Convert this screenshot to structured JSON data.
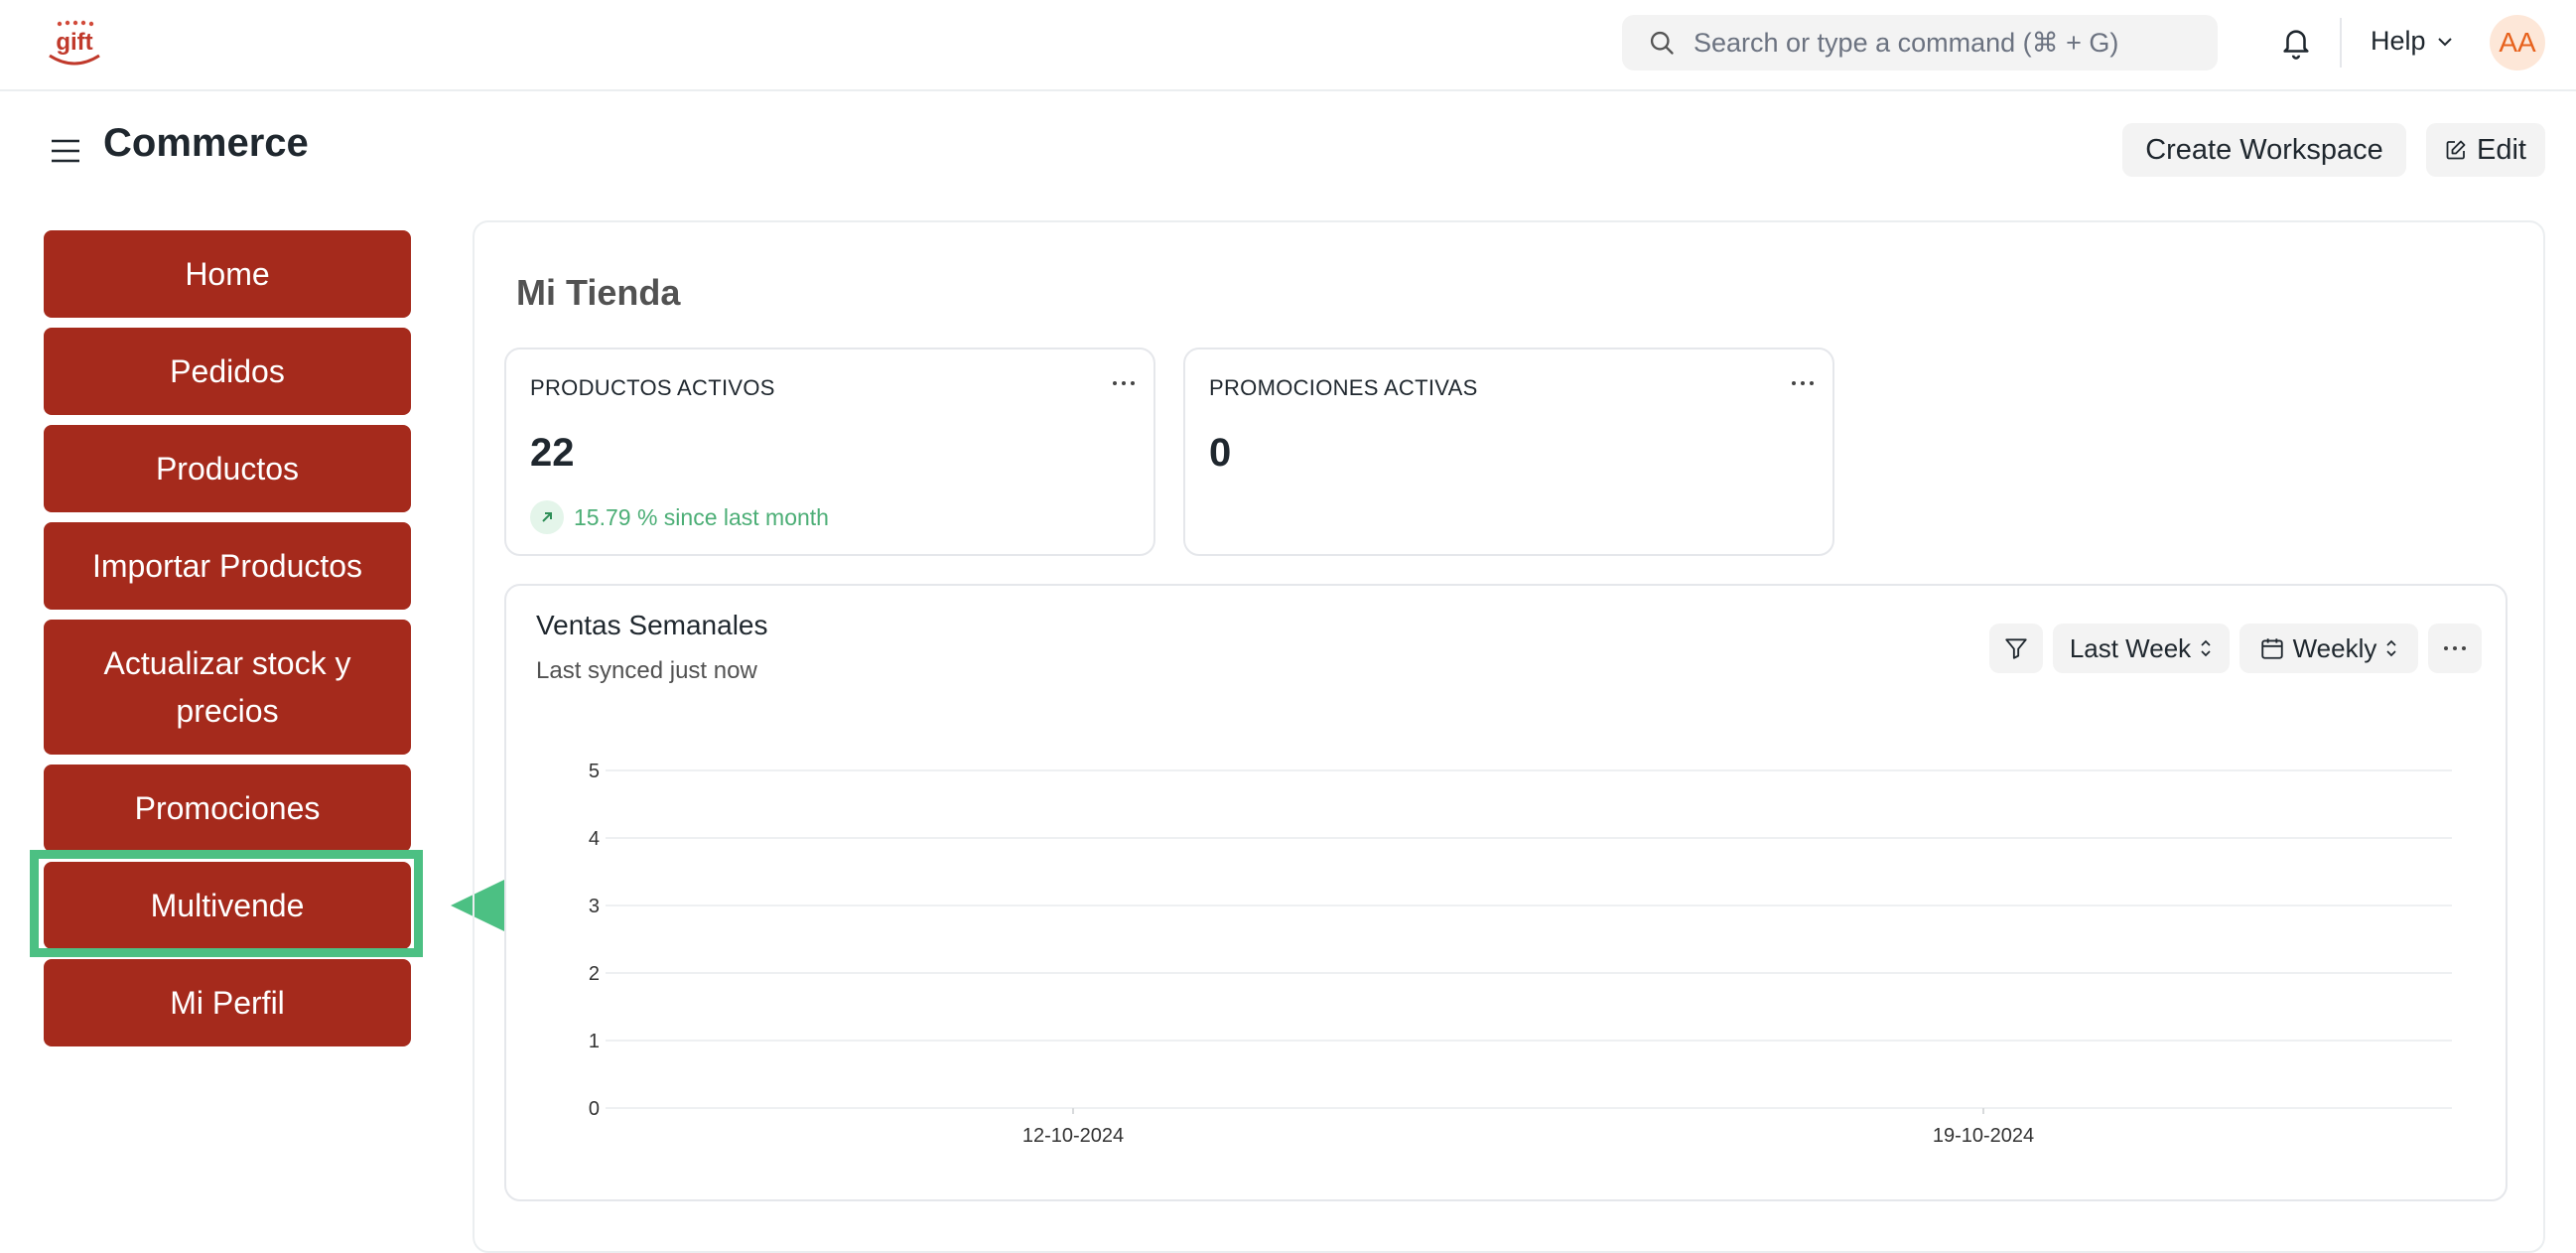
{
  "topbar": {
    "logo_text": "gift",
    "search_placeholder": "Search or type a command (⌘ + G)",
    "help_label": "Help",
    "avatar_initials": "AA"
  },
  "page": {
    "title": "Commerce",
    "create_workspace_label": "Create Workspace",
    "edit_label": "Edit"
  },
  "sidebar": {
    "items": [
      {
        "label": "Home"
      },
      {
        "label": "Pedidos"
      },
      {
        "label": "Productos"
      },
      {
        "label": "Importar Productos"
      },
      {
        "label": "Actualizar stock y precios"
      },
      {
        "label": "Promociones"
      },
      {
        "label": "Multivende"
      },
      {
        "label": "Mi Perfil"
      }
    ],
    "highlighted_index": 6
  },
  "workspace": {
    "title": "Mi Tienda",
    "cards": [
      {
        "label": "PRODUCTOS ACTIVOS",
        "value": "22",
        "trend": "15.79 % since last month"
      },
      {
        "label": "PROMOCIONES ACTIVAS",
        "value": "0"
      }
    ],
    "chart": {
      "title": "Ventas Semanales",
      "subtitle": "Last synced just now",
      "range_label": "Last Week",
      "interval_label": "Weekly"
    }
  },
  "colors": {
    "nav_button": "#a52a1c",
    "highlight": "#4cc083",
    "trend_positive": "#4cae76"
  },
  "chart_data": {
    "type": "line",
    "title": "",
    "x": [
      "12-10-2024",
      "19-10-2024"
    ],
    "series": [],
    "yticks": [
      0,
      1,
      2,
      3,
      4,
      5
    ],
    "ylim": [
      0,
      5
    ],
    "grid": true,
    "xlabel": "",
    "ylabel": ""
  }
}
